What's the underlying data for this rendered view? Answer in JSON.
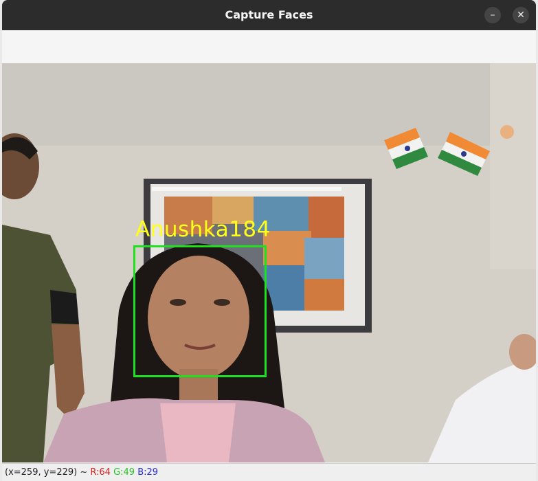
{
  "window": {
    "title": "Capture Faces",
    "minimize_icon": "–",
    "close_icon": "✕"
  },
  "detection": {
    "label": "Anushka184",
    "label_color": "#ffff1a",
    "box_color": "#1fe01f"
  },
  "status": {
    "coords": "(x=259, y=229) ~ ",
    "r": "R:64",
    "g": "G:49",
    "b": "B:29",
    "r_color": "#e0201c",
    "g_color": "#25c225",
    "b_color": "#2a2ad8"
  }
}
